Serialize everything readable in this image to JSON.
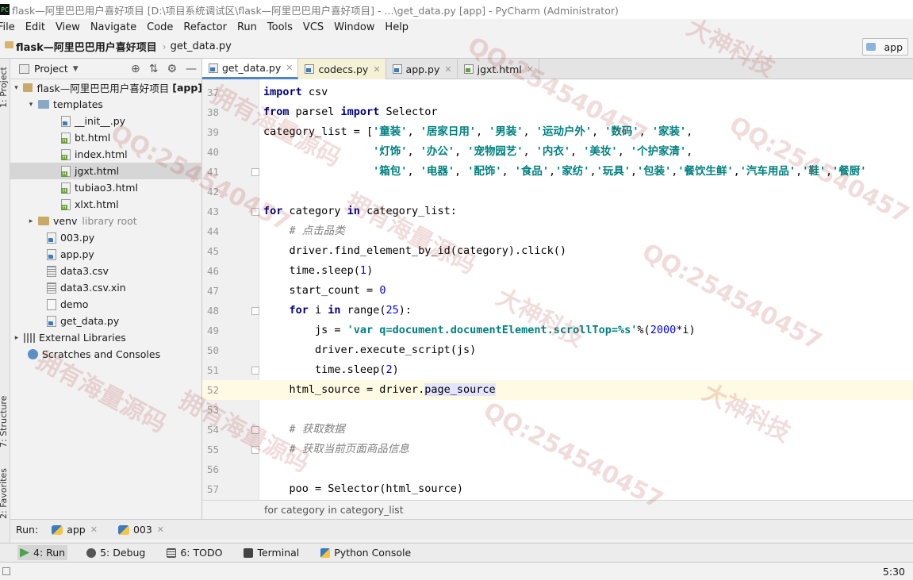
{
  "window": {
    "title": "flask—阿里巴巴用户喜好项目 [D:\\项目系统调试区\\flask—阿里巴巴用户喜好项目] - ...\\get_data.py [app] - PyCharm (Administrator)",
    "app_icon": "PC"
  },
  "menu": [
    "File",
    "Edit",
    "View",
    "Navigate",
    "Code",
    "Refactor",
    "Run",
    "Tools",
    "VCS",
    "Window",
    "Help"
  ],
  "navbar": {
    "project": "flask—阿里巴巴用户喜好项目",
    "file": "get_data.py",
    "run_config": "app"
  },
  "left_stripe": {
    "project": "1: Project",
    "structure": "7: Structure",
    "favorites": "2: Favorites"
  },
  "project_panel": {
    "title": "Project",
    "tree": [
      {
        "label": "flask—阿里巴巴用户喜好项目",
        "suffix": "[app]",
        "type": "folder",
        "level": 0,
        "arrow": "▾"
      },
      {
        "label": "templates",
        "type": "folder-blue",
        "level": 1,
        "arrow": "▾"
      },
      {
        "label": "__init__.py",
        "type": "py",
        "level": 2
      },
      {
        "label": "bt.html",
        "type": "html",
        "level": 2
      },
      {
        "label": "index.html",
        "type": "html",
        "level": 2
      },
      {
        "label": "jgxt.html",
        "type": "html",
        "level": 2,
        "selected": true
      },
      {
        "label": "tubiao3.html",
        "type": "html",
        "level": 2
      },
      {
        "label": "xlxt.html",
        "type": "html",
        "level": 2
      },
      {
        "label": "venv",
        "suffix": "library root",
        "type": "folder",
        "level": 1,
        "arrow": "▸"
      },
      {
        "label": "003.py",
        "type": "py",
        "level": 1
      },
      {
        "label": "app.py",
        "type": "py",
        "level": 1
      },
      {
        "label": "data3.csv",
        "type": "csv",
        "level": 1
      },
      {
        "label": "data3.csv.xin",
        "type": "csv",
        "level": 1
      },
      {
        "label": "demo",
        "type": "plain",
        "level": 1
      },
      {
        "label": "get_data.py",
        "type": "py",
        "level": 1
      },
      {
        "label": "External Libraries",
        "type": "lib",
        "level": 0,
        "arrow": "▸"
      },
      {
        "label": "Scratches and Consoles",
        "type": "scratch",
        "level": 0
      }
    ]
  },
  "tabs": [
    {
      "label": "get_data.py",
      "icon": "py",
      "active": true
    },
    {
      "label": "codecs.py",
      "icon": "py",
      "lib": true
    },
    {
      "label": "app.py",
      "icon": "py"
    },
    {
      "label": "jgxt.html",
      "icon": "html"
    }
  ],
  "editor": {
    "lines": [
      {
        "num": "37",
        "code": "import csv"
      },
      {
        "num": "38",
        "code": "from parsel import Selector"
      },
      {
        "num": "39",
        "code": "category_list = ['童装', '居家日用', '男装', '运动户外', '数码', '家装',"
      },
      {
        "num": "40",
        "code": "                 '灯饰', '办公', '宠物园艺', '内衣', '美妆', '个护家清',"
      },
      {
        "num": "41",
        "code": "                 '箱包', '电器', '配饰', '食品','家纺','玩具','包装','餐饮生鲜','汽车用品','鞋','餐厨'"
      },
      {
        "num": "42",
        "code": ""
      },
      {
        "num": "43",
        "code": "for category in category_list:"
      },
      {
        "num": "44",
        "code": "    # 点击品类"
      },
      {
        "num": "45",
        "code": "    driver.find_element_by_id(category).click()"
      },
      {
        "num": "46",
        "code": "    time.sleep(1)"
      },
      {
        "num": "47",
        "code": "    start_count = 0"
      },
      {
        "num": "48",
        "code": "    for i in range(25):"
      },
      {
        "num": "49",
        "code": "        js = 'var q=document.documentElement.scrollTop=%s'%(2000*i)"
      },
      {
        "num": "50",
        "code": "        driver.execute_script(js)"
      },
      {
        "num": "51",
        "code": "        time.sleep(2)"
      },
      {
        "num": "52",
        "code": "    html_source = driver.page_source"
      },
      {
        "num": "53",
        "code": ""
      },
      {
        "num": "54",
        "code": "    # 获取数据"
      },
      {
        "num": "55",
        "code": "    # 获取当前页面商品信息"
      },
      {
        "num": "56",
        "code": ""
      },
      {
        "num": "57",
        "code": "    poo = Selector(html_source)"
      }
    ],
    "breadcrumb": "for category in category_list"
  },
  "run_bar": {
    "label": "Run:",
    "tabs": [
      "app",
      "003"
    ]
  },
  "tool_windows": [
    {
      "label": "4: Run",
      "icon": "run",
      "active": true
    },
    {
      "label": "5: Debug",
      "icon": "debug"
    },
    {
      "label": "6: TODO",
      "icon": "todo"
    },
    {
      "label": "Terminal",
      "icon": "term"
    },
    {
      "label": "Python Console",
      "icon": "pycon"
    }
  ],
  "status": {
    "position": "5:30"
  },
  "watermarks": [
    "QQ:254540457",
    "拥有海量源码",
    "大神科技",
    "QQ:254540457",
    "拥有海量源码",
    "QQ:254540457",
    "大神科技",
    "拥有海量源码",
    "QQ:254540457",
    "QQ:254540457",
    "拥有海量源码",
    "大神科技"
  ]
}
